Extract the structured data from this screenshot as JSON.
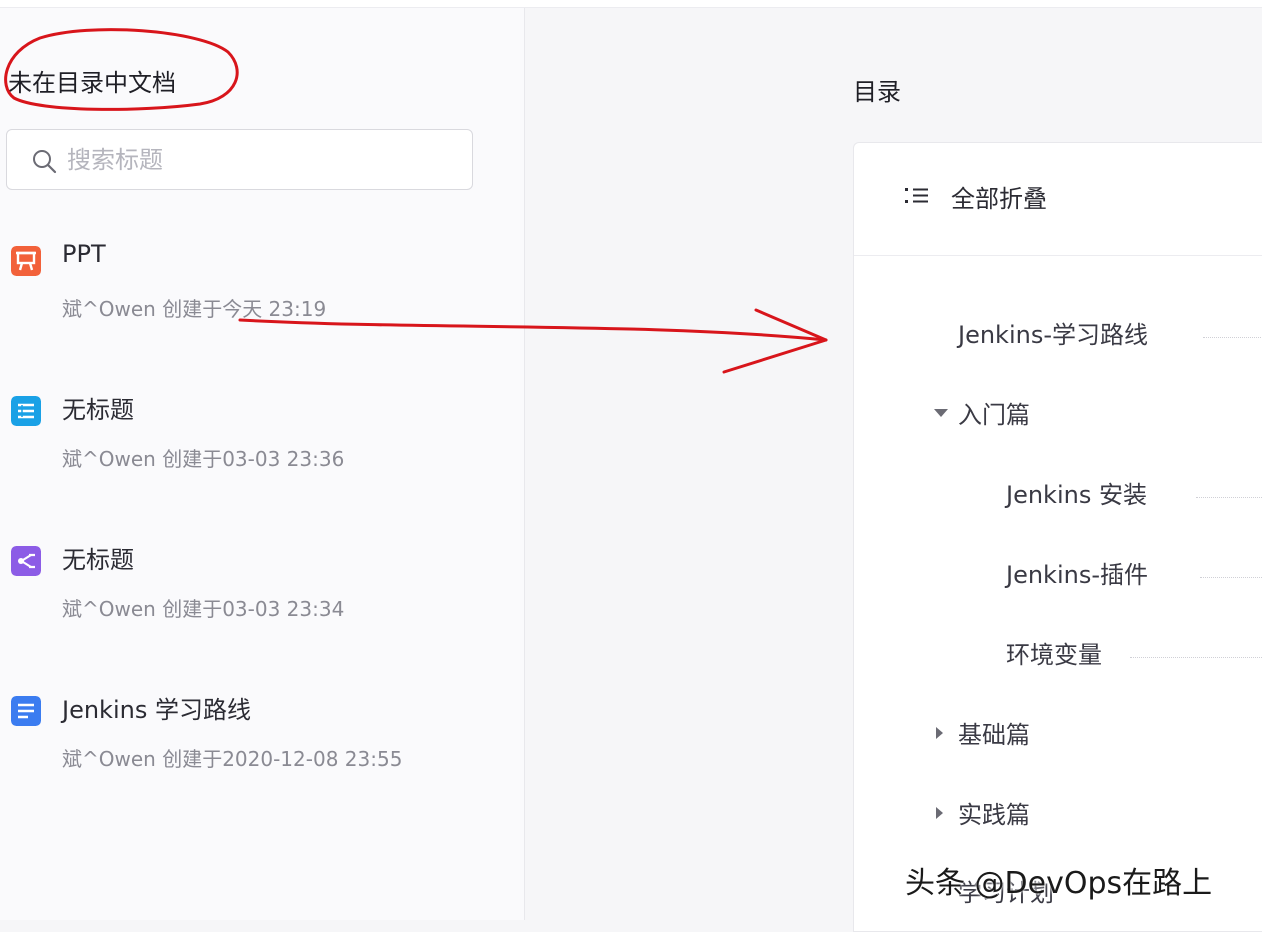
{
  "left_panel": {
    "title": "未在目录中文档",
    "search": {
      "placeholder": "搜索标题",
      "value": ""
    },
    "documents": [
      {
        "title": "PPT",
        "meta": "斌^Owen 创建于今天 23:19",
        "icon": "presentation-icon",
        "color": "#f2613a"
      },
      {
        "title": "无标题",
        "meta": "斌^Owen 创建于03-03 23:36",
        "icon": "table-doc-icon",
        "color": "#1aa1e6"
      },
      {
        "title": "无标题",
        "meta": "斌^Owen 创建于03-03 23:34",
        "icon": "mindmap-icon",
        "color": "#8c5ce6"
      },
      {
        "title": "Jenkins 学习路线",
        "meta": "斌^Owen 创建于2020-12-08 23:55",
        "icon": "document-icon",
        "color": "#3b7cf0"
      }
    ]
  },
  "toc": {
    "heading": "目录",
    "collapse_all": "全部折叠",
    "items": [
      {
        "label": "Jenkins-学习路线",
        "caret": "none"
      },
      {
        "label": "入门篇",
        "caret": "down"
      },
      {
        "label": "Jenkins 安装",
        "caret": "none"
      },
      {
        "label": "Jenkins-插件",
        "caret": "none"
      },
      {
        "label": "环境变量",
        "caret": "none"
      },
      {
        "label": "基础篇",
        "caret": "right"
      },
      {
        "label": "实践篇",
        "caret": "right"
      },
      {
        "label": "学习计划",
        "caret": "none"
      }
    ]
  },
  "watermark": "头条 @DevOps在路上",
  "annotation_color": "#d8151b"
}
